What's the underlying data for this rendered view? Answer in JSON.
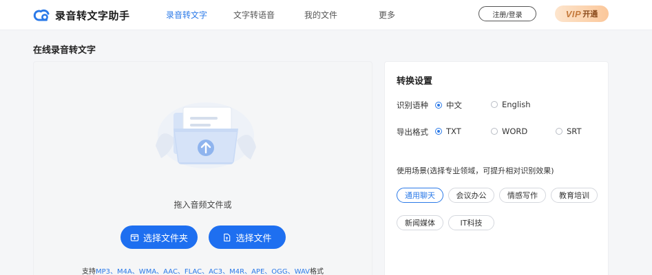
{
  "app": {
    "name": "录音转文字助手"
  },
  "nav": [
    {
      "label": "录音转文字",
      "active": true
    },
    {
      "label": "文字转语音",
      "active": false
    },
    {
      "label": "我的文件",
      "active": false
    },
    {
      "label": "更多",
      "active": false
    }
  ],
  "header": {
    "login_label": "注册/登录",
    "vip_word": "VIP",
    "vip_open": "开通"
  },
  "page": {
    "title": "在线录音转文字"
  },
  "upload": {
    "drag_text": "拖入音频文件或",
    "select_folder": "选择文件夹",
    "select_file": "选择文件",
    "formats_prefix": "支持",
    "formats_list": "MP3、M4A、WMA、AAC、FLAC、AC3、M4R、APE、OGG、WAV",
    "formats_suffix": "格式"
  },
  "settings": {
    "title": "转换设置",
    "language": {
      "label": "识别语种",
      "options": [
        "中文",
        "English"
      ],
      "selected": "中文"
    },
    "export": {
      "label": "导出格式",
      "options": [
        "TXT",
        "WORD",
        "SRT"
      ],
      "selected": "TXT"
    },
    "scene": {
      "label": "使用场景(选择专业领域，可提升相对识别效果)",
      "tags": [
        "通用聊天",
        "会议办公",
        "情感写作",
        "教育培训",
        "新闻媒体",
        "IT科技"
      ],
      "selected": "通用聊天"
    }
  },
  "colors": {
    "accent": "#2a79e8",
    "button": "#1e6ff0",
    "vip_start": "#fde5cd",
    "vip_end": "#fbc79a"
  },
  "icons": {
    "logo": "cloud-logo-icon",
    "upload": "upload-arrow-icon",
    "folder": "folder-icon",
    "file": "file-icon"
  }
}
